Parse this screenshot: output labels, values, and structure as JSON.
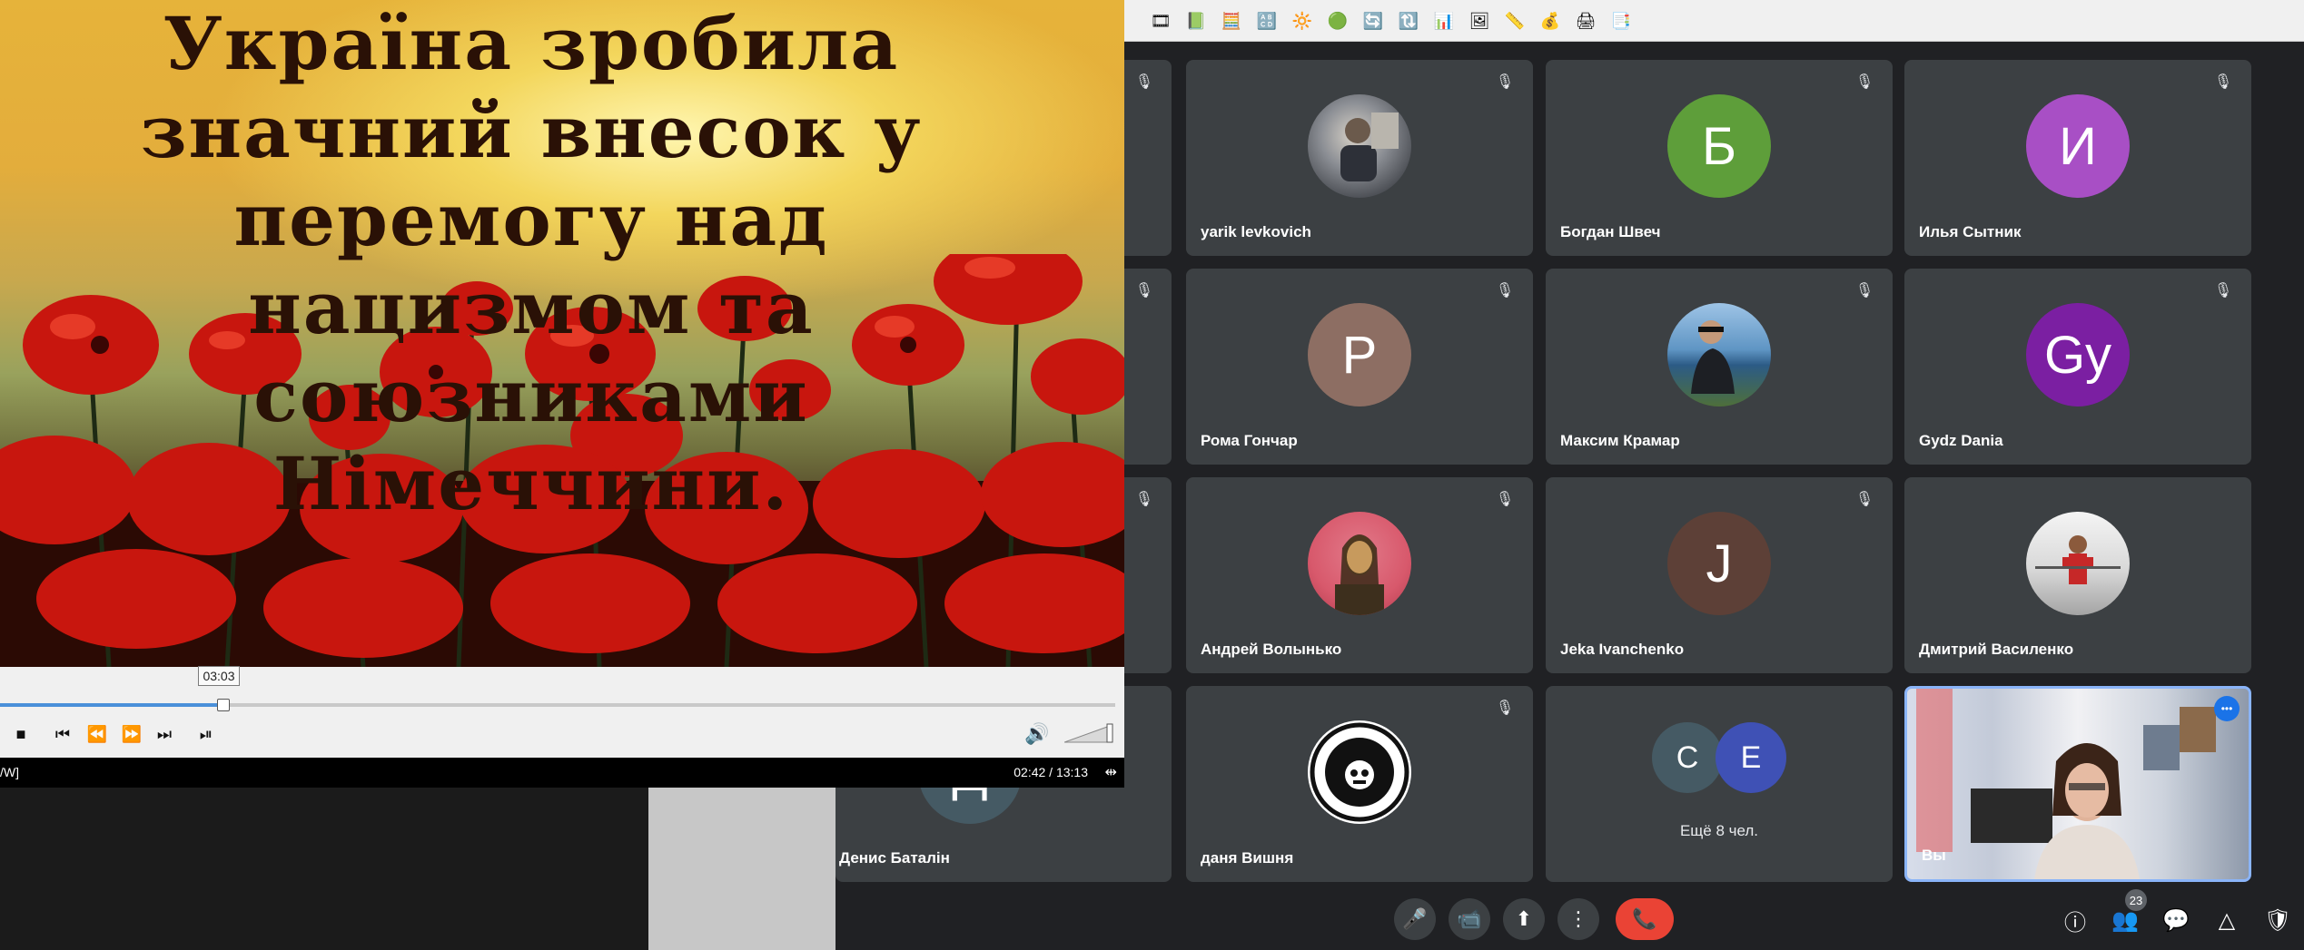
{
  "player": {
    "slide_title": "Україна зробила значний внесок у перемогу над нацизмом та союзниками Німеччини.",
    "seek_tooltip": "03:03",
    "progress_fraction": 0.2,
    "status_left": "/W]",
    "time": "02:42 / 13:13",
    "buttons": {
      "stop": "■",
      "prev": "⏮",
      "rewind": "⏪",
      "forward": "⏩",
      "next": "⏭",
      "frame_step": "⏯",
      "volume": "🔊",
      "extend": "⇹"
    }
  },
  "toolbar": {
    "icons": [
      "🎞",
      "📗",
      "🧮",
      "🔠",
      "🔆",
      "🟢",
      "🔄",
      "🔃",
      "📊",
      "🖼",
      "📏",
      "💰",
      "🖨",
      "📑"
    ]
  },
  "participants": [
    {
      "name": "yarik levkovich",
      "kind": "photo"
    },
    {
      "name": "Богдан Швеч",
      "initial": "Б",
      "color": "#5e9e3a"
    },
    {
      "name": "Илья Сытник",
      "initial": "И",
      "color": "#a84fc5"
    },
    {
      "name": "Рома Гончар",
      "initial": "Р",
      "color": "#8d6e63"
    },
    {
      "name": "Максим Крамар",
      "kind": "photo"
    },
    {
      "name": "Gydz Dania",
      "initial": "Gy",
      "color": "#7b1fa2"
    },
    {
      "name": "Андрей Волынько",
      "kind": "photo"
    },
    {
      "name": "Jeka Ivanchenko",
      "initial": "J",
      "color": "#5d4037"
    },
    {
      "name": "Дмитрий Василенко",
      "kind": "photo"
    },
    {
      "name": "даня Вишня",
      "kind": "photo"
    },
    {
      "name": "Денис Баталін",
      "initial": "Д",
      "color": "#455a64"
    }
  ],
  "more_tile": {
    "label": "Ещё 8 чел.",
    "initials": [
      "C",
      "E"
    ],
    "colors": [
      "#455a64",
      "#3f51b5"
    ]
  },
  "self_tile": {
    "name": "Вы",
    "more": "•••"
  },
  "controls": {
    "mic": "🎤",
    "camera": "📹",
    "present": "⬆",
    "more": "⋮",
    "hangup": "📞",
    "info": "ⓘ",
    "people": "👥",
    "people_count": "23",
    "chat": "💬",
    "activities": "△",
    "host": "🛡"
  },
  "icons": {
    "mic_off": "🎙"
  }
}
